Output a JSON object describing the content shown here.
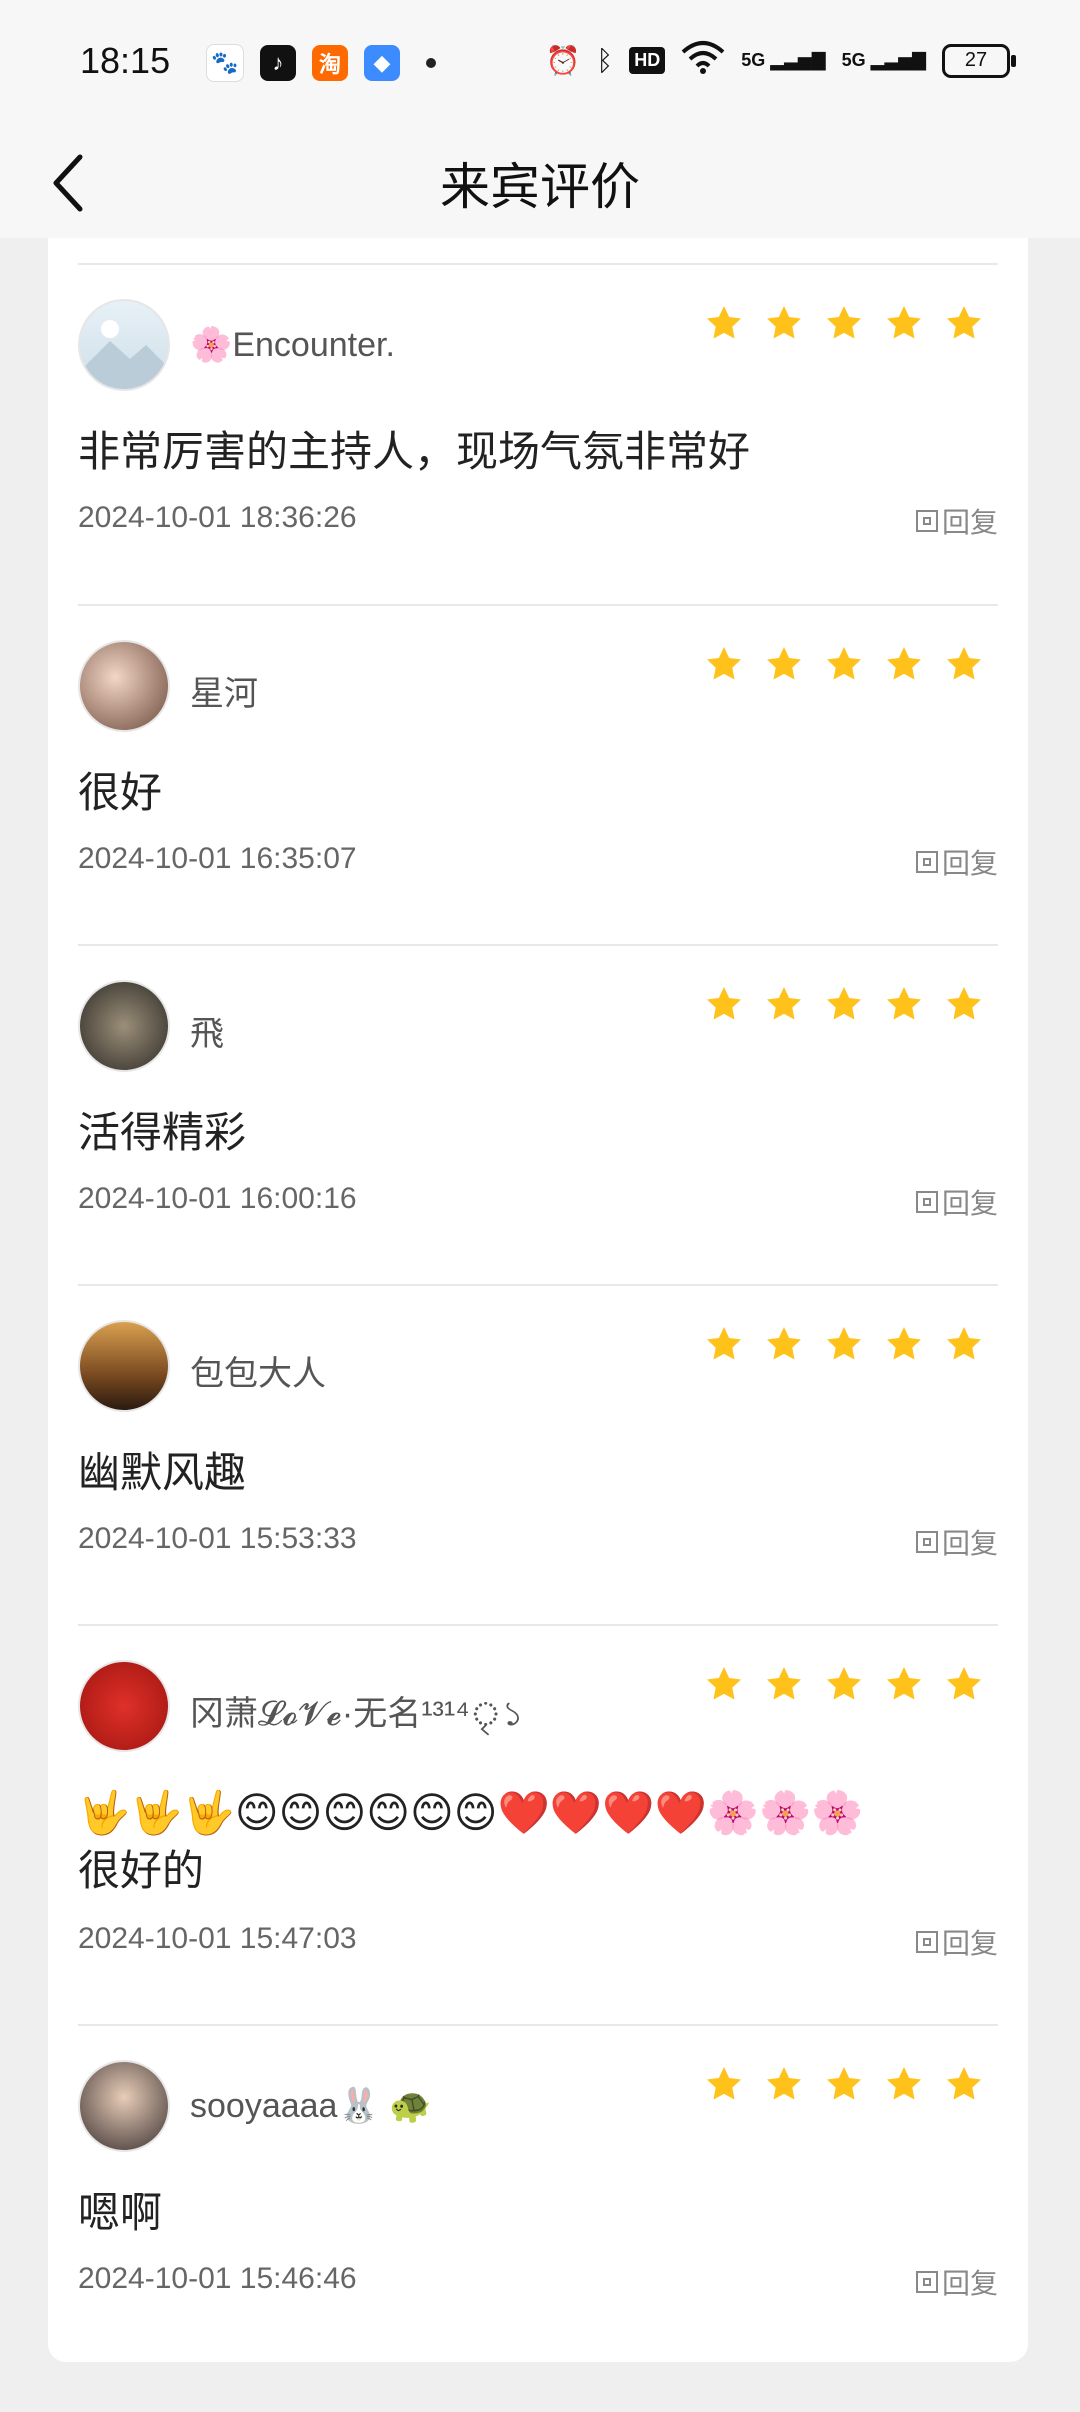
{
  "status": {
    "time": "18:15",
    "battery": "27",
    "hd": "HD",
    "net1": "5G",
    "net2": "5G"
  },
  "header": {
    "title": "来宾评价"
  },
  "reply_label": "回复",
  "reviews": [
    {
      "user": "🌸Encounter.",
      "comment": "非常厉害的主持人，现场气氛非常好",
      "date": "2024-10-01 18:36:26",
      "rating": 5
    },
    {
      "user": "星河",
      "comment": "很好",
      "date": "2024-10-01 16:35:07",
      "rating": 5
    },
    {
      "user": "飛",
      "comment": "活得精彩",
      "date": "2024-10-01 16:00:16",
      "rating": 5
    },
    {
      "user": "包包大人",
      "comment": "幽默风趣",
      "date": "2024-10-01 15:53:33",
      "rating": 5
    },
    {
      "user": "冈萧𝓛𝓸𝓥𝓮·无名¹³¹⁴ৃ১",
      "comment": "🤟🤟🤟😊😊😊😊😊😊❤️❤️❤️❤️🌸🌸🌸\n很好的",
      "date": "2024-10-01 15:47:03",
      "rating": 5
    },
    {
      "user": "sooyaaaa🐰 🐢",
      "comment": "嗯啊",
      "date": "2024-10-01 15:46:46",
      "rating": 5
    }
  ],
  "colors": {
    "star": "#FFC21A",
    "divider": "#e8e8e8"
  }
}
